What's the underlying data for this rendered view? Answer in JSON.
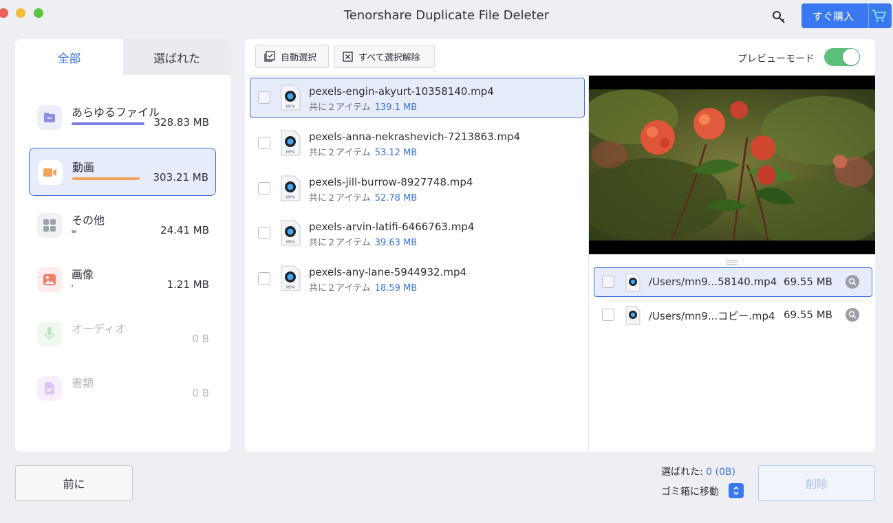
{
  "window": {
    "title": "Tenorshare Duplicate File Deleter"
  },
  "header": {
    "buy_label": "すぐ購入"
  },
  "tabs": {
    "all": "全部",
    "selected": "選ばれた"
  },
  "categories": [
    {
      "name": "あらゆるファイル",
      "size": "328.83 MB",
      "bar_fraction": 1.0,
      "color": "#7a7fe0"
    },
    {
      "name": "動画",
      "size": "303.21 MB",
      "bar_fraction": 0.92,
      "color": "#f1a45a"
    },
    {
      "name": "その他",
      "size": "24.41 MB",
      "bar_fraction": 0.07,
      "color": "#9ea2aa"
    },
    {
      "name": "画像",
      "size": "1.21 MB",
      "bar_fraction": 0.005,
      "color": "#ef7f66"
    },
    {
      "name": "オーディオ",
      "size": "0 B",
      "bar_fraction": 0,
      "color": "#9bd49a"
    },
    {
      "name": "書類",
      "size": "0 B",
      "bar_fraction": 0,
      "color": "#c9a6e8"
    }
  ],
  "toolbar": {
    "auto_select": "自動選択",
    "deselect_all": "すべて選択解除",
    "preview_mode": "プレビューモード"
  },
  "files": [
    {
      "name": "pexels-engin-akyurt-10358140.mp4",
      "meta": "共に２アイテム",
      "size": "139.1 MB"
    },
    {
      "name": "pexels-anna-nekrashevich-7213863.mp4",
      "meta": "共に２アイテム",
      "size": "53.12 MB"
    },
    {
      "name": "pexels-jill-burrow-8927748.mp4",
      "meta": "共に２アイテム",
      "size": "52.78 MB"
    },
    {
      "name": "pexels-arvin-latifi-6466763.mp4",
      "meta": "共に２アイテム",
      "size": "39.63 MB"
    },
    {
      "name": "pexels-any-lane-5944932.mp4",
      "meta": "共に２アイテム",
      "size": "18.59 MB"
    }
  ],
  "duplicates": [
    {
      "path": "/Users/mn9...58140.mp4",
      "size": "69.55 MB"
    },
    {
      "path": "/Users/mn9...コピー.mp4",
      "size": "69.55 MB"
    }
  ],
  "footer": {
    "prev_label": "前に",
    "selected_label": "選ばれた:",
    "selected_value": "0 (0B)",
    "trash_label": "ゴミ箱に移動",
    "delete_label": "削除"
  }
}
